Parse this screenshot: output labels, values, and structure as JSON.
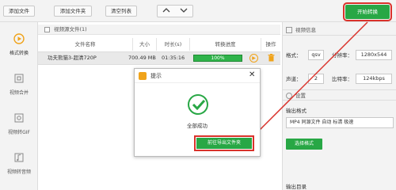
{
  "toolbar": {
    "add_file": "添加文件",
    "add_folder": "添加文件夹",
    "clear_list": "清空列表",
    "up_arrow": "^",
    "down_arrow": "v",
    "start_convert": "开始转换"
  },
  "sidebar": {
    "items": [
      {
        "label": "格式转换"
      },
      {
        "label": "视频合并"
      },
      {
        "label": "视频转GIF"
      },
      {
        "label": "视频转音频"
      }
    ]
  },
  "file_list": {
    "header": "视频源文件(1)",
    "columns": [
      "文件名称",
      "大小",
      "时长(s)",
      "转换进度",
      "操作"
    ],
    "rows": [
      {
        "name": "功夫熊猫3-超清720P",
        "size": "700.49 MB",
        "duration": "01:35:16",
        "progress_text": "100%",
        "progress": 1.0
      }
    ]
  },
  "video_info": {
    "header": "视频信息",
    "format_label": "格式：",
    "format_value": "qsv",
    "resolution_label": "分辨率：",
    "resolution_value": "1280x544",
    "channel_label": "声道：",
    "channel_value": "2",
    "bitrate_label": "比特率：",
    "bitrate_value": "124kbps"
  },
  "settings": {
    "header": "设置",
    "output_format_label": "输出格式",
    "output_format_value": "MP4 同源文件 自动 标清 极速",
    "select_format_button": "选择格式",
    "output_dir_label": "输出目录"
  },
  "dialog": {
    "title": "提示",
    "message": "全部成功",
    "open_folder_button": "前往导出文件夹",
    "close": "✕"
  },
  "colors": {
    "accent_green": "#28a745",
    "highlight_red": "#d9322b",
    "icon_orange": "#f0a31a"
  }
}
